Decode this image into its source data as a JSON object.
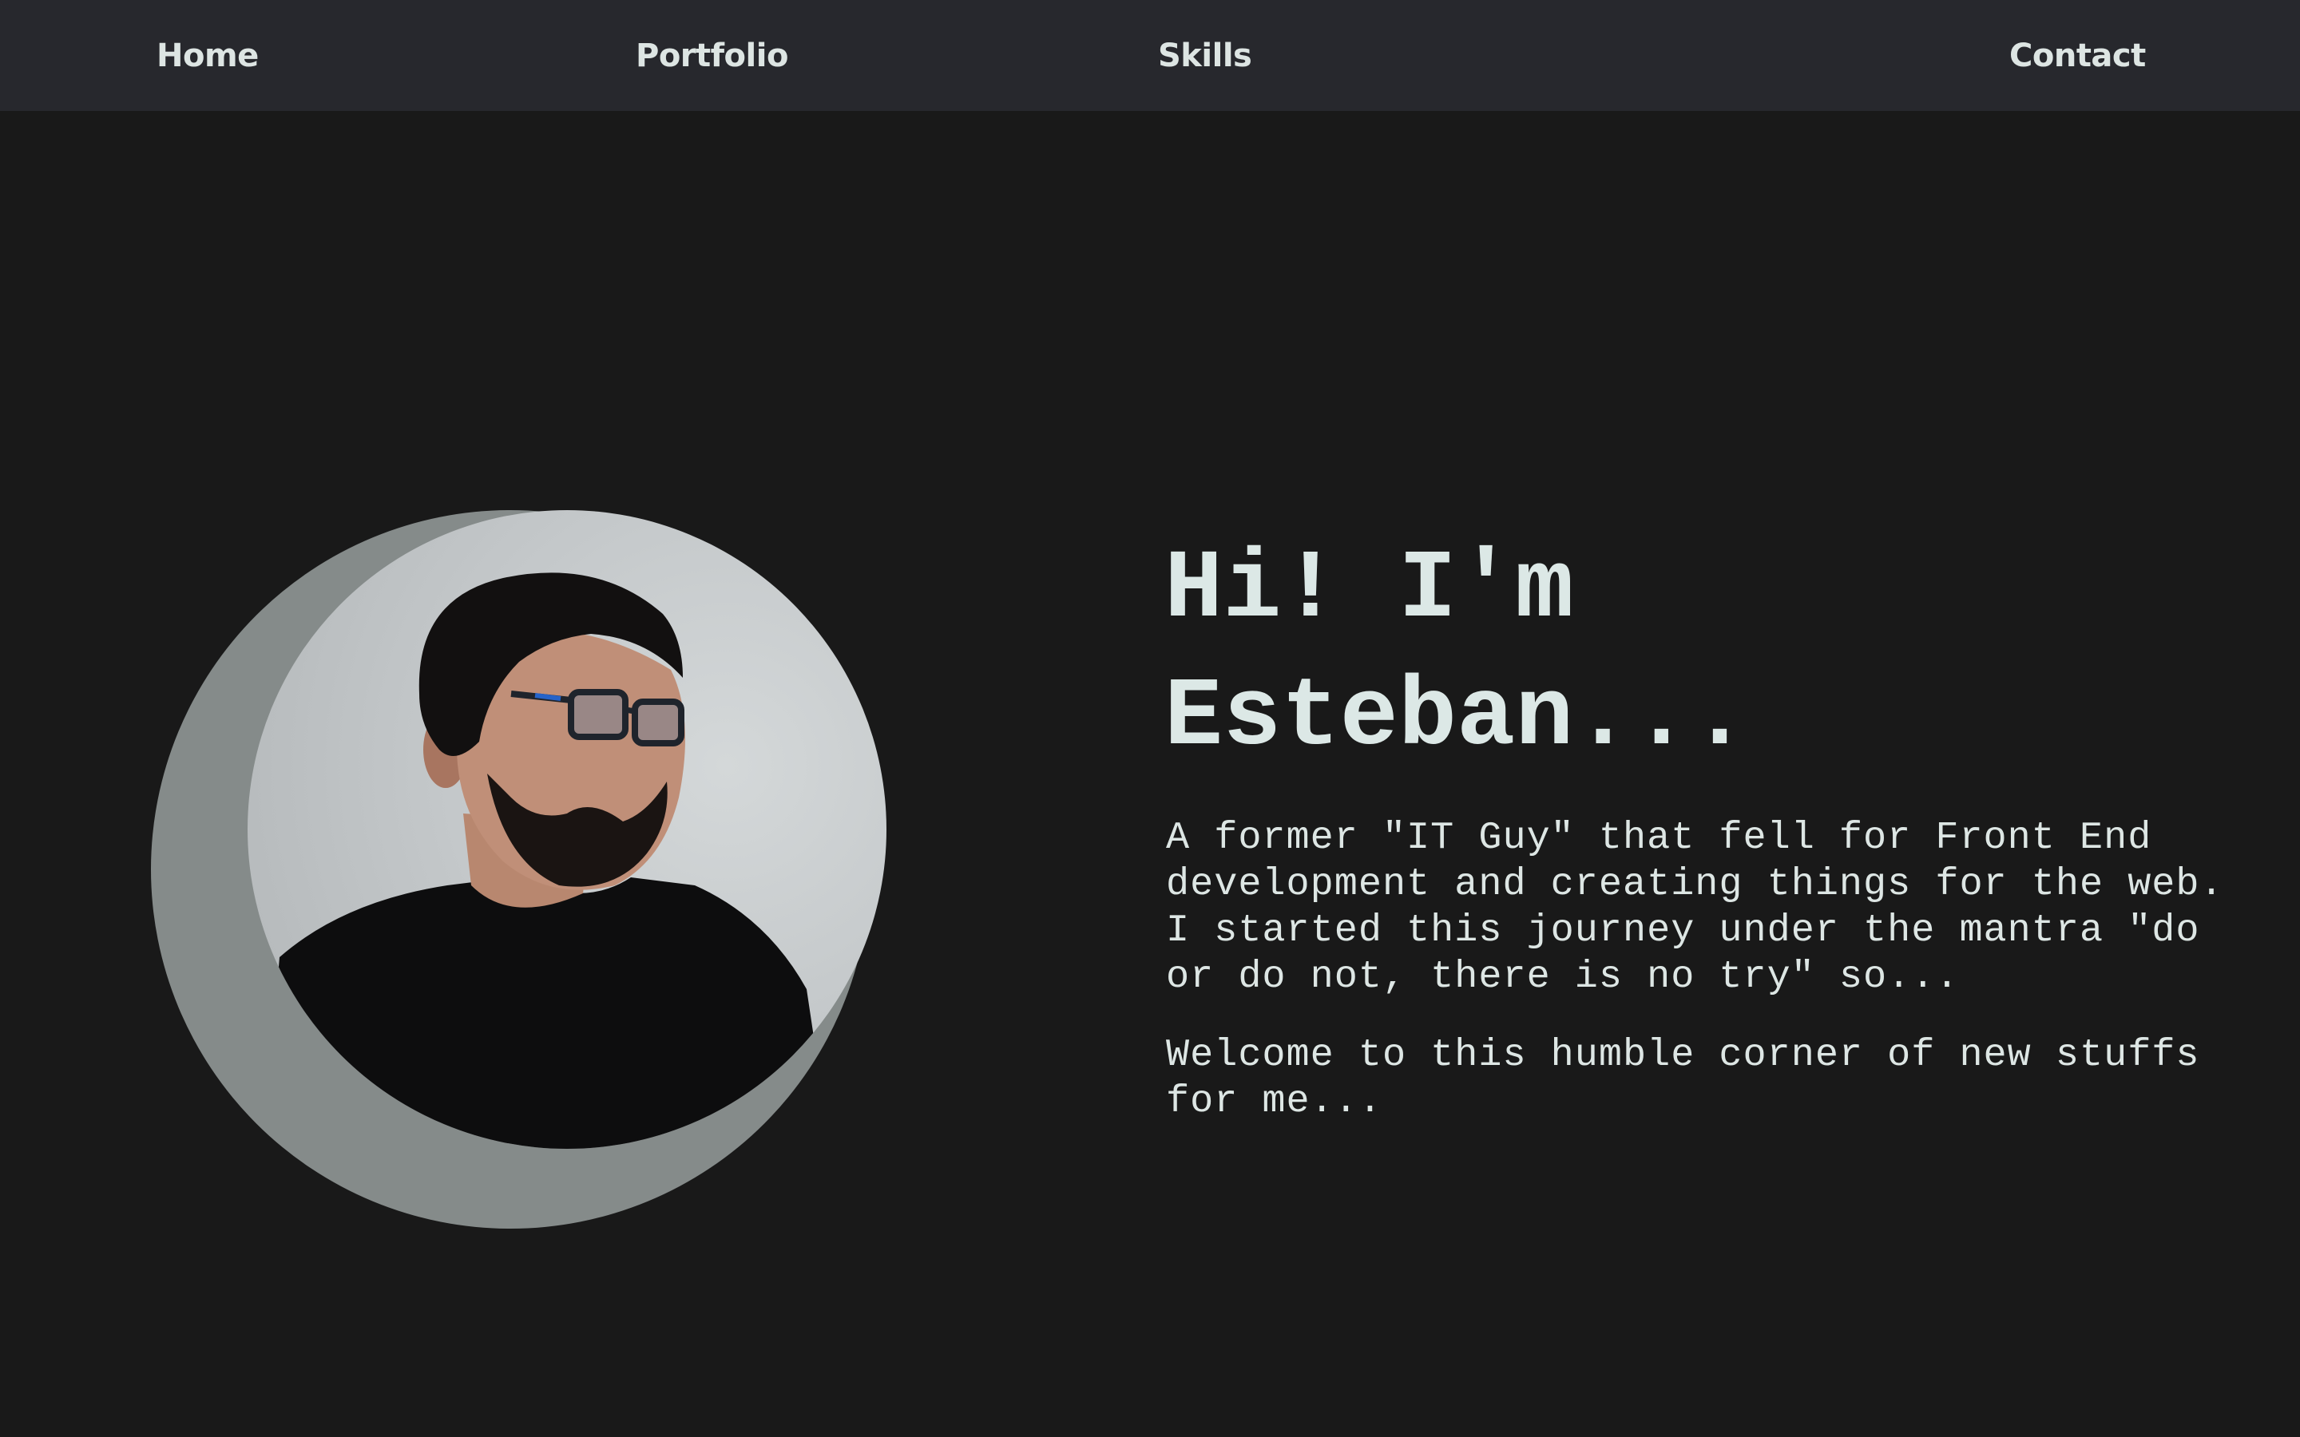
{
  "nav": {
    "items": [
      {
        "label": "Home"
      },
      {
        "label": "Portfolio"
      },
      {
        "label": "Skills"
      },
      {
        "label": "Contact"
      }
    ]
  },
  "hero": {
    "headline": "Hi! I'm\nEsteban...",
    "paragraphs": [
      "A former \"IT Guy\" that fell for Front End development and creating things for the web. I started this journey under the mantra \"do or do not, there is no try\" so...",
      "Welcome to this humble corner of new stuffs for me..."
    ],
    "portrait_icon": "profile-photo",
    "colors": {
      "background": "#191919",
      "navbar": "#27282d",
      "backdrop_circle": "#858b8a",
      "text": "#dce8e6"
    }
  }
}
